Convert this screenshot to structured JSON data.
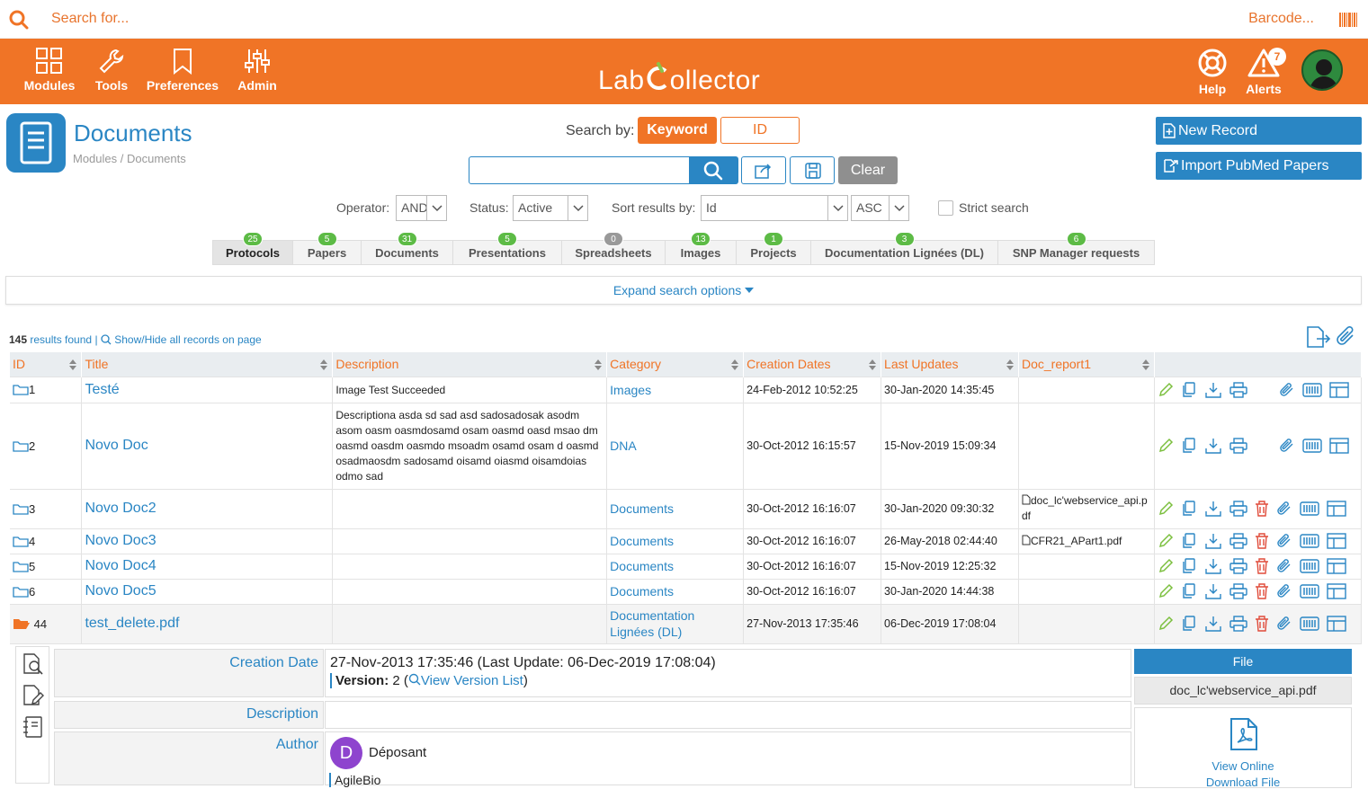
{
  "topbar": {
    "search_placeholder": "Search for...",
    "barcode_label": "Barcode..."
  },
  "nav": {
    "items": [
      {
        "label": "Modules",
        "icon": "grid-icon"
      },
      {
        "label": "Tools",
        "icon": "wrench-icon"
      },
      {
        "label": "Preferences",
        "icon": "bookmark-icon"
      },
      {
        "label": "Admin",
        "icon": "sliders-icon"
      }
    ],
    "logo": {
      "part1": "Lab",
      "part2": "ollector"
    },
    "help_label": "Help",
    "alerts_label": "Alerts",
    "alerts_count": "7"
  },
  "header": {
    "title": "Documents",
    "breadcrumb": "Modules / Documents"
  },
  "search": {
    "by_label": "Search by:",
    "keyword_label": "Keyword",
    "id_label": "ID",
    "clear_label": "Clear"
  },
  "actions": {
    "new_record": "New Record",
    "import_pubmed": "Import PubMed Papers"
  },
  "filters": {
    "operator_label": "Operator:",
    "operator_value": "AND",
    "status_label": "Status:",
    "status_value": "Active",
    "sort_label": "Sort results by:",
    "sort_value": "Id",
    "order_value": "ASC",
    "strict_label": "Strict search"
  },
  "tabs": [
    {
      "label": "Protocols",
      "count": "25"
    },
    {
      "label": "Papers",
      "count": "5"
    },
    {
      "label": "Documents",
      "count": "31"
    },
    {
      "label": "Presentations",
      "count": "5"
    },
    {
      "label": "Spreadsheets",
      "count": "0"
    },
    {
      "label": "Images",
      "count": "13"
    },
    {
      "label": "Projects",
      "count": "1"
    },
    {
      "label": "Documentation Lignées (DL)",
      "count": "3"
    },
    {
      "label": "SNP Manager requests",
      "count": "6"
    }
  ],
  "expand_label": "Expand search options",
  "results": {
    "count": "145",
    "found_label": "results found",
    "separator": "|",
    "toggle_label": "Show/Hide all records on page"
  },
  "table": {
    "columns": [
      "ID",
      "Title",
      "Description",
      "Category",
      "Creation Dates",
      "Last Updates",
      "Doc_report1"
    ],
    "rows": [
      {
        "id": "1",
        "title": "Testé",
        "description": "Image Test Succeeded",
        "category": "Images",
        "created": "24-Feb-2012 10:52:25",
        "updated": "30-Jan-2020 14:35:45",
        "doc": ""
      },
      {
        "id": "2",
        "title": "Novo Doc",
        "description": "Descriptiona asda sd sad asd sadosadosak asodm asom oasm oasmdosamd osam oasmd oasd msao dm oasmd oasdm oasmdo msoadm osamd osam d oasmd osadmaosdm sadosamd oisamd oiasmd oisamdoias odmo sad",
        "category": "DNA",
        "created": "30-Oct-2012 16:15:57",
        "updated": "15-Nov-2019 15:09:34",
        "doc": ""
      },
      {
        "id": "3",
        "title": "Novo Doc2",
        "description": "",
        "category": "Documents",
        "created": "30-Oct-2012 16:16:07",
        "updated": "30-Jan-2020 09:30:32",
        "doc": "doc_lc'webservice_api.pdf"
      },
      {
        "id": "4",
        "title": "Novo Doc3",
        "description": "",
        "category": "Documents",
        "created": "30-Oct-2012 16:16:07",
        "updated": "26-May-2018 02:44:40",
        "doc": "CFR21_APart1.pdf"
      },
      {
        "id": "5",
        "title": "Novo Doc4",
        "description": "",
        "category": "Documents",
        "created": "30-Oct-2012 16:16:07",
        "updated": "15-Nov-2019 12:25:32",
        "doc": ""
      },
      {
        "id": "6",
        "title": "Novo Doc5",
        "description": "",
        "category": "Documents",
        "created": "30-Oct-2012 16:16:07",
        "updated": "30-Jan-2020 14:44:38",
        "doc": ""
      },
      {
        "id": "44",
        "title": "test_delete.pdf",
        "description": "",
        "category": "Documentation Lignées (DL)",
        "created": "27-Nov-2013 17:35:46",
        "updated": "06-Dec-2019 17:08:04",
        "doc": ""
      }
    ]
  },
  "detail": {
    "creation_label": "Creation Date",
    "creation_value": "27-Nov-2013 17:35:46 (Last Update: 06-Dec-2019 17:08:04)",
    "version_label": "Version:",
    "version_value": "2",
    "version_link": "View Version List",
    "description_label": "Description",
    "author_label": "Author",
    "author_initial": "D",
    "author_name": "Déposant",
    "author_org": "AgileBio",
    "file_header": "File",
    "file_name": "doc_lc'webservice_api.pdf",
    "view_online": "View Online",
    "download_file": "Download File"
  }
}
